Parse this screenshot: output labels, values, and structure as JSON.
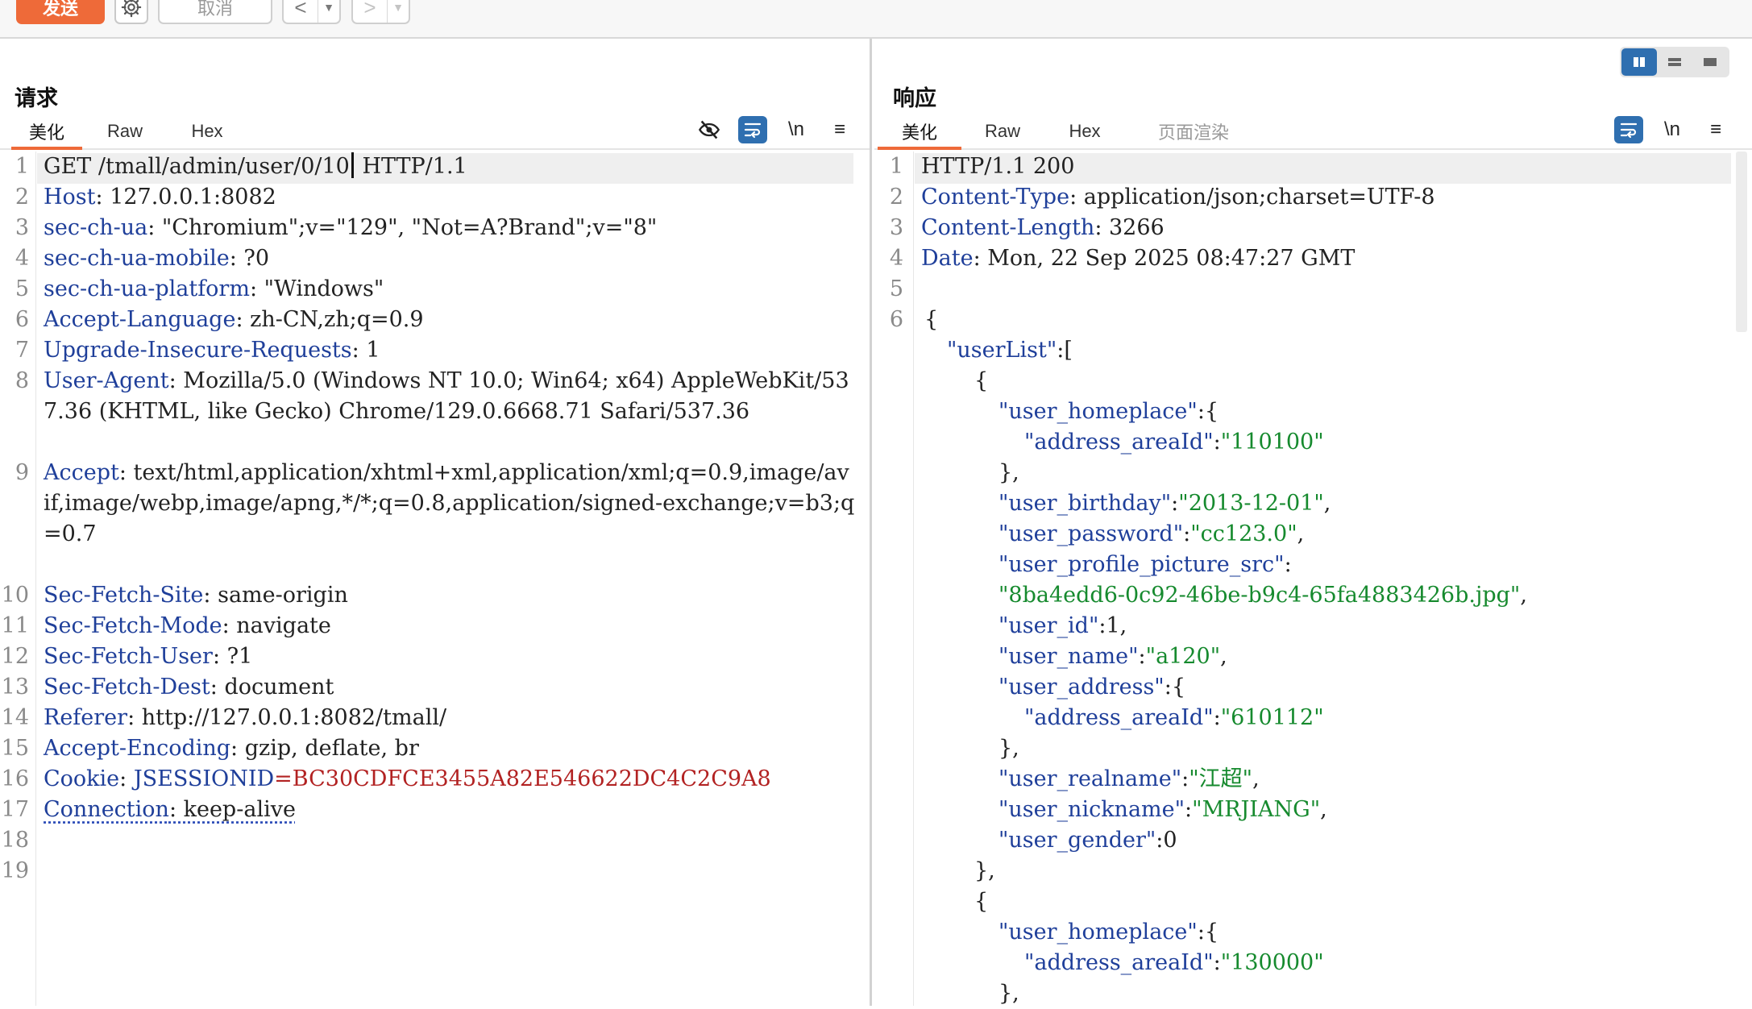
{
  "toolbar": {
    "send_label": "发送",
    "cancel_label": "取消",
    "back_glyph": "<",
    "forward_glyph": ">",
    "dropdown_glyph": "▼"
  },
  "request": {
    "title": "请求",
    "tabs": [
      "美化",
      "Raw",
      "Hex"
    ],
    "active_tab": "美化",
    "tools": [
      "eye-off-icon",
      "wrap-icon",
      "\\n",
      "≡"
    ],
    "line_numbers": [
      "1",
      "2",
      "3",
      "4",
      "5",
      "6",
      "7",
      "8",
      "9",
      "10",
      "11",
      "12",
      "13",
      "14",
      "15",
      "16",
      "17",
      "18",
      "19"
    ],
    "lines": {
      "l1a": "GET /tmall/admin/user/0/10",
      "l1b": " HTTP/1.1",
      "l2k": "Host",
      "l2v": ": 127.0.0.1:8082",
      "l3k": "sec-ch-ua",
      "l3v": ": \"Chromium\";v=\"129\", \"Not=A?Brand\";v=\"8\"",
      "l4k": "sec-ch-ua-mobile",
      "l4v": ": ?0",
      "l5k": "sec-ch-ua-platform",
      "l5v": ": \"Windows\"",
      "l6k": "Accept-Language",
      "l6v": ": zh-CN,zh;q=0.9",
      "l7k": "Upgrade-Insecure-Requests",
      "l7v": ": 1",
      "l8k": "User-Agent",
      "l8v": ": Mozilla/5.0 (Windows NT 10.0; Win64; x64) AppleWebKit/537.36 (KHTML, like Gecko) Chrome/129.0.6668.71 Safari/537.36",
      "l9k": "Accept",
      "l9v": ": text/html,application/xhtml+xml,application/xml;q=0.9,image/avif,image/webp,image/apng,*/*;q=0.8,application/signed-exchange;v=b3;q=0.7",
      "l10k": "Sec-Fetch-Site",
      "l10v": ": same-origin",
      "l11k": "Sec-Fetch-Mode",
      "l11v": ": navigate",
      "l12k": "Sec-Fetch-User",
      "l12v": ": ?1",
      "l13k": "Sec-Fetch-Dest",
      "l13v": ": document",
      "l14k": "Referer",
      "l14v": ": http://127.0.0.1:8082/tmall/",
      "l15k": "Accept-Encoding",
      "l15v": ": gzip, deflate, br",
      "l16k": "Cookie",
      "l16c": ": ",
      "l16n": "JSESSIONID",
      "l16e": "=",
      "l16v": "BC30CDFCE3455A82E546622DC4C2C9A8",
      "l17k": "Connection",
      "l17v": ": keep-alive"
    }
  },
  "response": {
    "title": "响应",
    "tabs": [
      "美化",
      "Raw",
      "Hex",
      "页面渲染"
    ],
    "active_tab": "美化",
    "tools": [
      "wrap-icon",
      "\\n",
      "≡"
    ],
    "line_numbers": [
      "1",
      "2",
      "3",
      "4",
      "5",
      "6"
    ],
    "lines": {
      "r1": "HTTP/1.1 200",
      "r2k": "Content-Type",
      "r2v": ": application/json;charset=UTF-8",
      "r3k": "Content-Length",
      "r3v": ": 3266",
      "r4k": "Date",
      "r4v": ": Mon, 22 Sep 2025 08:47:27 GMT",
      "j1": "{",
      "j2k": "\"userList\"",
      "j2p": ":[",
      "j3": "{",
      "j4k": "\"user_homeplace\"",
      "j4p": ":{",
      "j5k": "\"address_areaId\"",
      "j5p": ":",
      "j5v": "\"110100\"",
      "j6": "},",
      "j7k": "\"user_birthday\"",
      "j7p": ":",
      "j7v": "\"2013-12-01\"",
      "j7e": ",",
      "j8k": "\"user_password\"",
      "j8p": ":",
      "j8v": "\"cc123.0\"",
      "j8e": ",",
      "j9k": "\"user_profile_picture_src\"",
      "j9p": ":",
      "j10v": "\"8ba4edd6-0c92-46be-b9c4-65fa4883426b.jpg\"",
      "j10e": ",",
      "j11k": "\"user_id\"",
      "j11p": ":1,",
      "j12k": "\"user_name\"",
      "j12p": ":",
      "j12v": "\"a120\"",
      "j12e": ",",
      "j13k": "\"user_address\"",
      "j13p": ":{",
      "j14k": "\"address_areaId\"",
      "j14p": ":",
      "j14v": "\"610112\"",
      "j15": "},",
      "j16k": "\"user_realname\"",
      "j16p": ":",
      "j16v": "\"江超\"",
      "j16e": ",",
      "j17k": "\"user_nickname\"",
      "j17p": ":",
      "j17v": "\"MRJIANG\"",
      "j17e": ",",
      "j18k": "\"user_gender\"",
      "j18p": ":0",
      "j19": "},",
      "j20": "{",
      "j21k": "\"user_homeplace\"",
      "j21p": ":{",
      "j22k": "\"address_areaId\"",
      "j22p": ":",
      "j22v": "\"130000\"",
      "j23": "},"
    }
  },
  "colors": {
    "accent": "#ee6a39",
    "selected_blue": "#2f6fb0",
    "header_key": "#1f3f9a",
    "cookie_value": "#b22222",
    "json_value": "#168a2e"
  }
}
